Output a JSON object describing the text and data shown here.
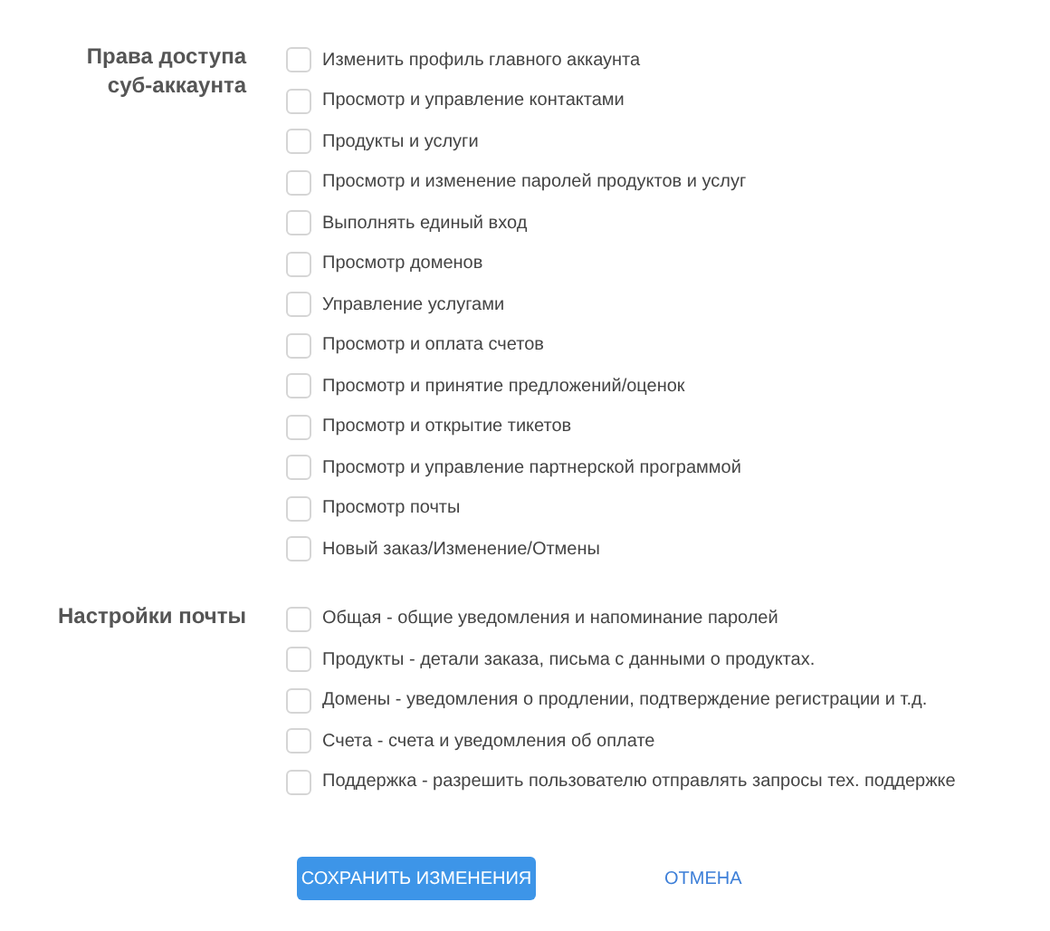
{
  "sections": [
    {
      "label": "Права доступа суб-аккаунта",
      "options": [
        {
          "label": "Изменить профиль главного аккаунта",
          "checked": false
        },
        {
          "label": "Просмотр и управление контактами",
          "checked": false
        },
        {
          "label": "Продукты и услуги",
          "checked": false
        },
        {
          "label": "Просмотр и изменение паролей продуктов и услуг",
          "checked": false
        },
        {
          "label": "Выполнять единый вход",
          "checked": false
        },
        {
          "label": "Просмотр доменов",
          "checked": false
        },
        {
          "label": "Управление услугами",
          "checked": false
        },
        {
          "label": "Просмотр и оплата счетов",
          "checked": false
        },
        {
          "label": "Просмотр и принятие предложений/оценок",
          "checked": false
        },
        {
          "label": "Просмотр и открытие тикетов",
          "checked": false
        },
        {
          "label": "Просмотр и управление партнерской программой",
          "checked": false
        },
        {
          "label": "Просмотр почты",
          "checked": false
        },
        {
          "label": "Новый заказ/Изменение/Отмены",
          "checked": false
        }
      ]
    },
    {
      "label": "Настройки почты",
      "options": [
        {
          "label": "Общая - общие уведомления и напоминание паролей",
          "checked": false
        },
        {
          "label": "Продукты - детали заказа, письма с данными о продуктах.",
          "checked": false
        },
        {
          "label": "Домены - уведомления о продлении, подтверждение регистрации и т.д.",
          "checked": false
        },
        {
          "label": "Счета - счета и уведомления об оплате",
          "checked": false
        },
        {
          "label": "Поддержка - разрешить пользователю отправлять запросы тех. поддержке",
          "checked": false
        }
      ]
    }
  ],
  "buttons": {
    "save": "СОХРАНИТЬ ИЗМЕНЕНИЯ",
    "cancel": "ОТМЕНА"
  }
}
